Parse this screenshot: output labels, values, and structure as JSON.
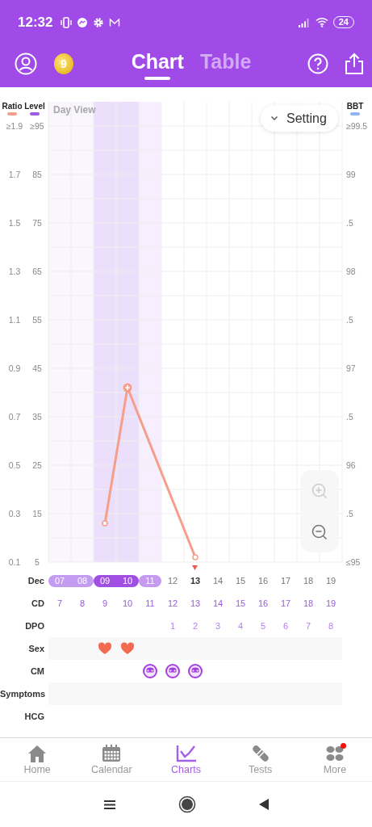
{
  "status_bar": {
    "time": "12:32",
    "battery": "24"
  },
  "header": {
    "coin": "9",
    "tabs": [
      {
        "label": "Chart",
        "selected": true
      },
      {
        "label": "Table",
        "selected": false
      }
    ]
  },
  "chart": {
    "level_legend": {
      "label": "Level",
      "color": "#9b5de5"
    },
    "bbt_legend": {
      "label": "BBT",
      "color": "#92b4f4"
    },
    "view_label": "Day View",
    "setting_button": "Setting",
    "level_ticks": [
      "≥95",
      "85",
      "75",
      "65",
      "55",
      "45",
      "35",
      "25",
      "15",
      "5"
    ],
    "bbt_ticks": [
      "≥99.5",
      "99",
      ".5",
      "98",
      ".5",
      "97",
      ".5",
      "96",
      ".5",
      "≤95"
    ],
    "chart_data": {
      "type": "line",
      "grid": true,
      "ylim": [
        0.1,
        1.9
      ],
      "yticks": [
        {
          "value": 1.9,
          "label": "≥1.9"
        },
        1.7,
        1.5,
        1.3,
        1.1,
        0.9,
        0.7,
        0.5,
        0.3,
        0.1
      ],
      "series": [
        {
          "name": "Ratio",
          "color": "#f59e8a",
          "marker": "circle",
          "values": [
            null,
            null,
            0.26,
            0.82,
            null,
            null,
            0.12,
            null,
            null,
            null,
            null,
            null,
            null
          ]
        }
      ]
    }
  },
  "rows": [
    {
      "label": "Dec",
      "kind": "date",
      "shaded": false
    },
    {
      "label": "CD",
      "kind": "cd",
      "shaded": false
    },
    {
      "label": "DPO",
      "kind": "dpo",
      "shaded": false
    },
    {
      "label": "Sex",
      "kind": "sex",
      "shaded": true
    },
    {
      "label": "CM",
      "kind": "cm",
      "shaded": false
    },
    {
      "label": "Symptoms",
      "kind": "symptoms",
      "shaded": true
    },
    {
      "label": "HCG",
      "kind": "hcg",
      "shaded": false
    }
  ],
  "days": [
    {
      "date": "07",
      "cd": "7",
      "kind": "fertile",
      "today": false,
      "peak": false,
      "sex": false,
      "cm": false
    },
    {
      "date": "08",
      "cd": "8",
      "kind": "fertile",
      "today": false,
      "peak": false,
      "sex": false,
      "cm": false
    },
    {
      "date": "09",
      "cd": "9",
      "kind": "peak",
      "today": false,
      "peak": false,
      "sex": true,
      "cm": false
    },
    {
      "date": "10",
      "cd": "10",
      "kind": "peak",
      "today": false,
      "peak": true,
      "sex": true,
      "cm": false
    },
    {
      "date": "11",
      "cd": "11",
      "kind": "late",
      "today": false,
      "peak": false,
      "sex": false,
      "cm": true
    },
    {
      "date": "12",
      "cd": "12",
      "dpo": "1",
      "kind": "none",
      "today": false,
      "peak": false,
      "sex": false,
      "cm": true
    },
    {
      "date": "13",
      "cd": "13",
      "dpo": "2",
      "kind": "none",
      "today": true,
      "peak": false,
      "sex": false,
      "cm": true
    },
    {
      "date": "14",
      "cd": "14",
      "dpo": "3",
      "kind": "none",
      "today": false,
      "peak": false,
      "sex": false,
      "cm": false
    },
    {
      "date": "15",
      "cd": "15",
      "dpo": "4",
      "kind": "none",
      "today": false,
      "peak": false,
      "sex": false,
      "cm": false
    },
    {
      "date": "16",
      "cd": "16",
      "dpo": "5",
      "kind": "none",
      "today": false,
      "peak": false,
      "sex": false,
      "cm": false
    },
    {
      "date": "17",
      "cd": "17",
      "dpo": "6",
      "kind": "none",
      "today": false,
      "peak": false,
      "sex": false,
      "cm": false
    },
    {
      "date": "18",
      "cd": "18",
      "dpo": "7",
      "kind": "none",
      "today": false,
      "peak": false,
      "sex": false,
      "cm": false
    },
    {
      "date": "19",
      "cd": "19",
      "dpo": "8",
      "kind": "none",
      "today": false,
      "peak": false,
      "sex": false,
      "cm": false
    }
  ],
  "nav": [
    {
      "label": "Home",
      "kind": "home",
      "selected": false,
      "badge": false
    },
    {
      "label": "Calendar",
      "kind": "calendar",
      "selected": false,
      "badge": false
    },
    {
      "label": "Charts",
      "kind": "charts",
      "selected": true,
      "badge": false
    },
    {
      "label": "Tests",
      "kind": "tests",
      "selected": false,
      "badge": false
    },
    {
      "label": "More",
      "kind": "more",
      "selected": false,
      "badge": true
    }
  ]
}
